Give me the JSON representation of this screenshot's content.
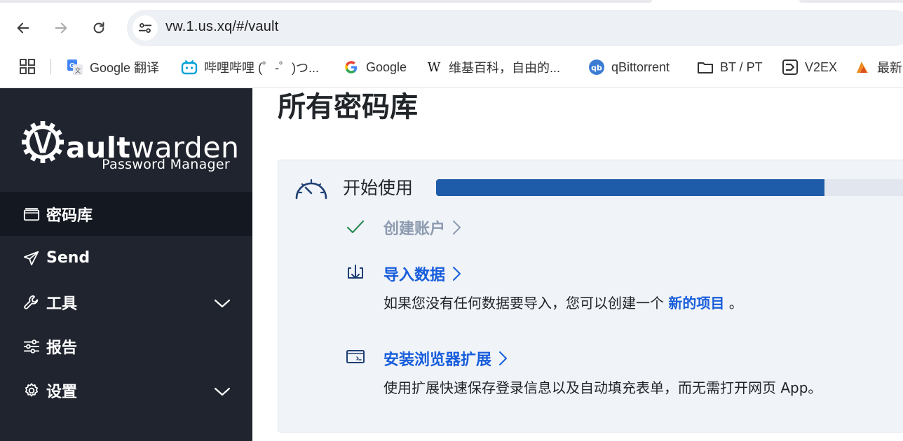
{
  "browser": {
    "url": "vw.1.us.xq/#/vault",
    "bookmarks": [
      {
        "label": "Google 翻译",
        "icon": "google-translate-icon"
      },
      {
        "label": "哔哩哔哩 (゜-゜)つ...",
        "icon": "bilibili-icon"
      },
      {
        "label": "Google",
        "icon": "google-icon"
      },
      {
        "label": "维基百科，自由的...",
        "icon": "wikipedia-icon"
      },
      {
        "label": "qBittorrent",
        "icon": "qbittorrent-icon"
      },
      {
        "label": "BT / PT",
        "icon": "folder-icon"
      },
      {
        "label": "V2EX",
        "icon": "v2ex-icon"
      },
      {
        "label": "最新",
        "icon": "bookmark-icon"
      }
    ]
  },
  "logo": {
    "brand_bold": "ault",
    "brand_regular": "warden",
    "tagline": "Password Manager"
  },
  "sidebar": {
    "items": [
      {
        "label": "密码库",
        "icon": "vault-icon",
        "active": true
      },
      {
        "label": "Send",
        "icon": "send-icon"
      },
      {
        "label": "工具",
        "icon": "wrench-icon",
        "expandable": true
      },
      {
        "label": "报告",
        "icon": "sliders-icon"
      },
      {
        "label": "设置",
        "icon": "gear-icon",
        "expandable": true
      }
    ]
  },
  "main": {
    "title": "所有密码库",
    "getting_started": {
      "title": "开始使用",
      "progress_fraction": 0.77,
      "steps": [
        {
          "title": "创建账户",
          "done": true
        },
        {
          "title": "导入数据",
          "desc_prefix": "如果您没有任何数据要导入，您可以创建一个",
          "desc_link": "新的项目",
          "desc_suffix": "。"
        },
        {
          "title": "安装浏览器扩展",
          "desc": "使用扩展快速保存登录信息以及自动填充表单，而无需打开网页 App。"
        }
      ]
    }
  },
  "colors": {
    "sidebar_bg": "#1f242e",
    "accent": "#175ddc",
    "progress": "#1e5ba8"
  }
}
